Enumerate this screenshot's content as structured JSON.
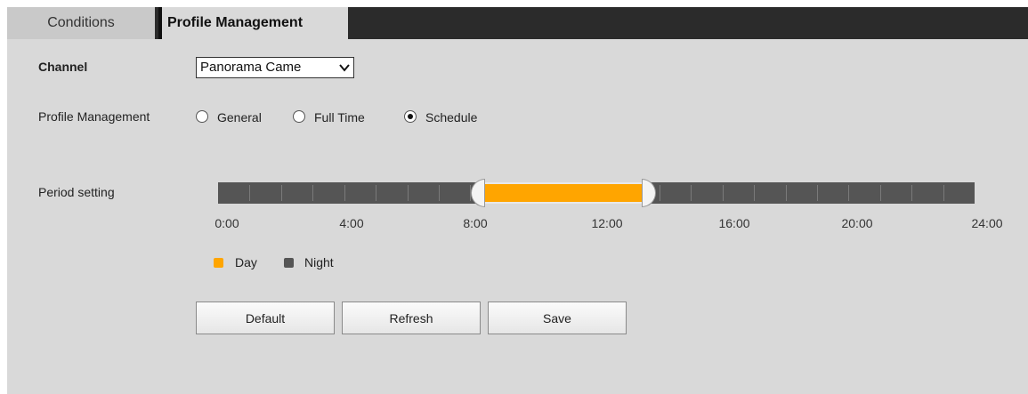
{
  "tabs": [
    {
      "label": "Conditions",
      "active": false
    },
    {
      "label": "Profile Management",
      "active": true
    }
  ],
  "channel": {
    "label": "Channel",
    "selected": "Panorama Came"
  },
  "profile_management": {
    "label": "Profile Management",
    "options": [
      {
        "label": "General",
        "checked": false
      },
      {
        "label": "Full Time",
        "checked": false
      },
      {
        "label": "Schedule",
        "checked": true
      }
    ]
  },
  "period": {
    "label": "Period setting",
    "range_hours": [
      0,
      24
    ],
    "day_start_hour": 8.4,
    "day_end_hour": 13.5,
    "tick_labels": [
      "0:00",
      "4:00",
      "8:00",
      "12:00",
      "16:00",
      "20:00",
      "24:00"
    ]
  },
  "legend": {
    "day_label": "Day",
    "night_label": "Night",
    "day_color": "#ffa500",
    "night_color": "#555555"
  },
  "buttons": {
    "default_label": "Default",
    "refresh_label": "Refresh",
    "save_label": "Save"
  }
}
